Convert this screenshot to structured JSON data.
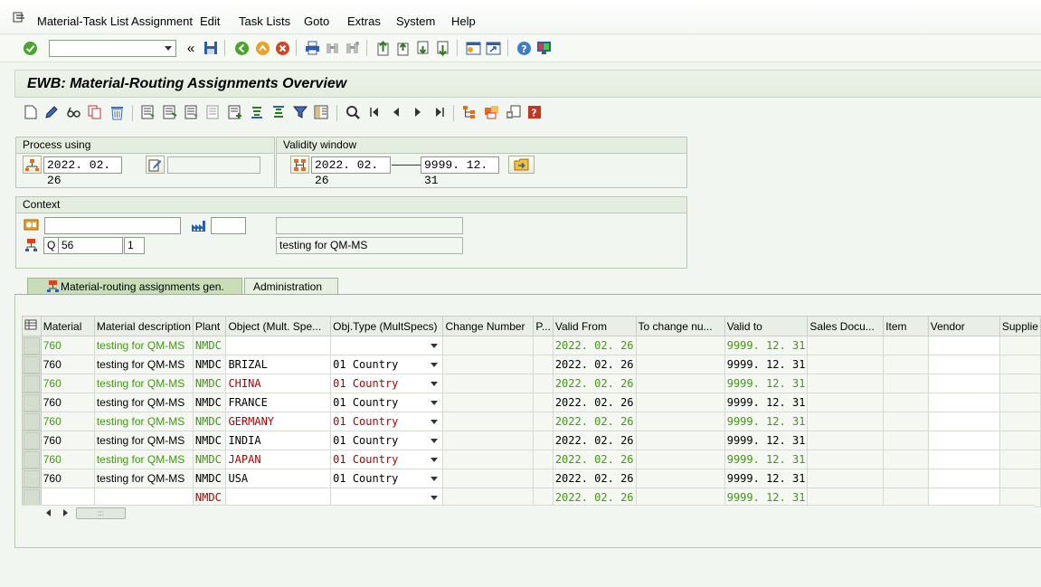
{
  "menu": {
    "items": [
      "Material-Task List Assignment",
      "Edit",
      "Task Lists",
      "Goto",
      "Extras",
      "System",
      "Help"
    ]
  },
  "toolbar": {
    "command_field_value": "",
    "back_glyph": "«"
  },
  "title": "EWB: Material-Routing Assignments Overview",
  "process_using": {
    "label": "Process using",
    "date": "2022. 02. 26",
    "change_number": ""
  },
  "validity_window": {
    "label": "Validity window",
    "from": "2022. 02. 26",
    "to": "9999. 12. 31"
  },
  "context": {
    "label": "Context",
    "material": "",
    "plant": "",
    "material_desc": "",
    "tasklist_type": "Q",
    "group": "56",
    "counter": "1",
    "tasklist_desc": "testing for QM-MS"
  },
  "tabs": {
    "active": "Material-routing assignments gen.",
    "inactive": "Administration"
  },
  "table": {
    "columns": [
      "Material",
      "Material description",
      "Plant",
      "Object (Mult. Spe...",
      "Obj.Type (MultSpecs)",
      "Change Number",
      "P...",
      "Valid From",
      "To change nu...",
      "Valid to",
      "Sales Docu...",
      "Item",
      "Vendor",
      "Supplie"
    ],
    "rows": [
      {
        "material": "760",
        "desc": "testing for QM-MS",
        "plant": "NMDC",
        "object": "",
        "objtype": "",
        "valid_from": "2022. 02. 26",
        "valid_to": "9999. 12. 31",
        "style": "green"
      },
      {
        "material": "760",
        "desc": "testing for QM-MS",
        "plant": "NMDC",
        "object": "BRIZAL",
        "objtype": "01 Country",
        "valid_from": "2022. 02. 26",
        "valid_to": "9999. 12. 31",
        "style": "black"
      },
      {
        "material": "760",
        "desc": "testing for QM-MS",
        "plant": "NMDC",
        "object": "CHINA",
        "objtype": "01 Country",
        "valid_from": "2022. 02. 26",
        "valid_to": "9999. 12. 31",
        "style": "green"
      },
      {
        "material": "760",
        "desc": "testing for QM-MS",
        "plant": "NMDC",
        "object": "FRANCE",
        "objtype": "01 Country",
        "valid_from": "2022. 02. 26",
        "valid_to": "9999. 12. 31",
        "style": "black"
      },
      {
        "material": "760",
        "desc": "testing for QM-MS",
        "plant": "NMDC",
        "object": "GERMANY",
        "objtype": "01 Country",
        "valid_from": "2022. 02. 26",
        "valid_to": "9999. 12. 31",
        "style": "green"
      },
      {
        "material": "760",
        "desc": "testing for QM-MS",
        "plant": "NMDC",
        "object": "INDIA",
        "objtype": "01 Country",
        "valid_from": "2022. 02. 26",
        "valid_to": "9999. 12. 31",
        "style": "black"
      },
      {
        "material": "760",
        "desc": "testing for QM-MS",
        "plant": "NMDC",
        "object": "JAPAN",
        "objtype": "01 Country",
        "valid_from": "2022. 02. 26",
        "valid_to": "9999. 12. 31",
        "style": "green"
      },
      {
        "material": "760",
        "desc": "testing for QM-MS",
        "plant": "NMDC",
        "object": "USA",
        "objtype": "01 Country",
        "valid_from": "2022. 02. 26",
        "valid_to": "9999. 12. 31",
        "style": "black"
      },
      {
        "material": "",
        "desc": "",
        "plant": "NMDC",
        "object": "",
        "objtype": "",
        "valid_from": "2022. 02. 26",
        "valid_to": "9999. 12. 31",
        "style": "new"
      }
    ]
  },
  "colors": {
    "green_text": "#3f9a0c",
    "red_text": "#b00000",
    "background": "#f2f6f0"
  }
}
